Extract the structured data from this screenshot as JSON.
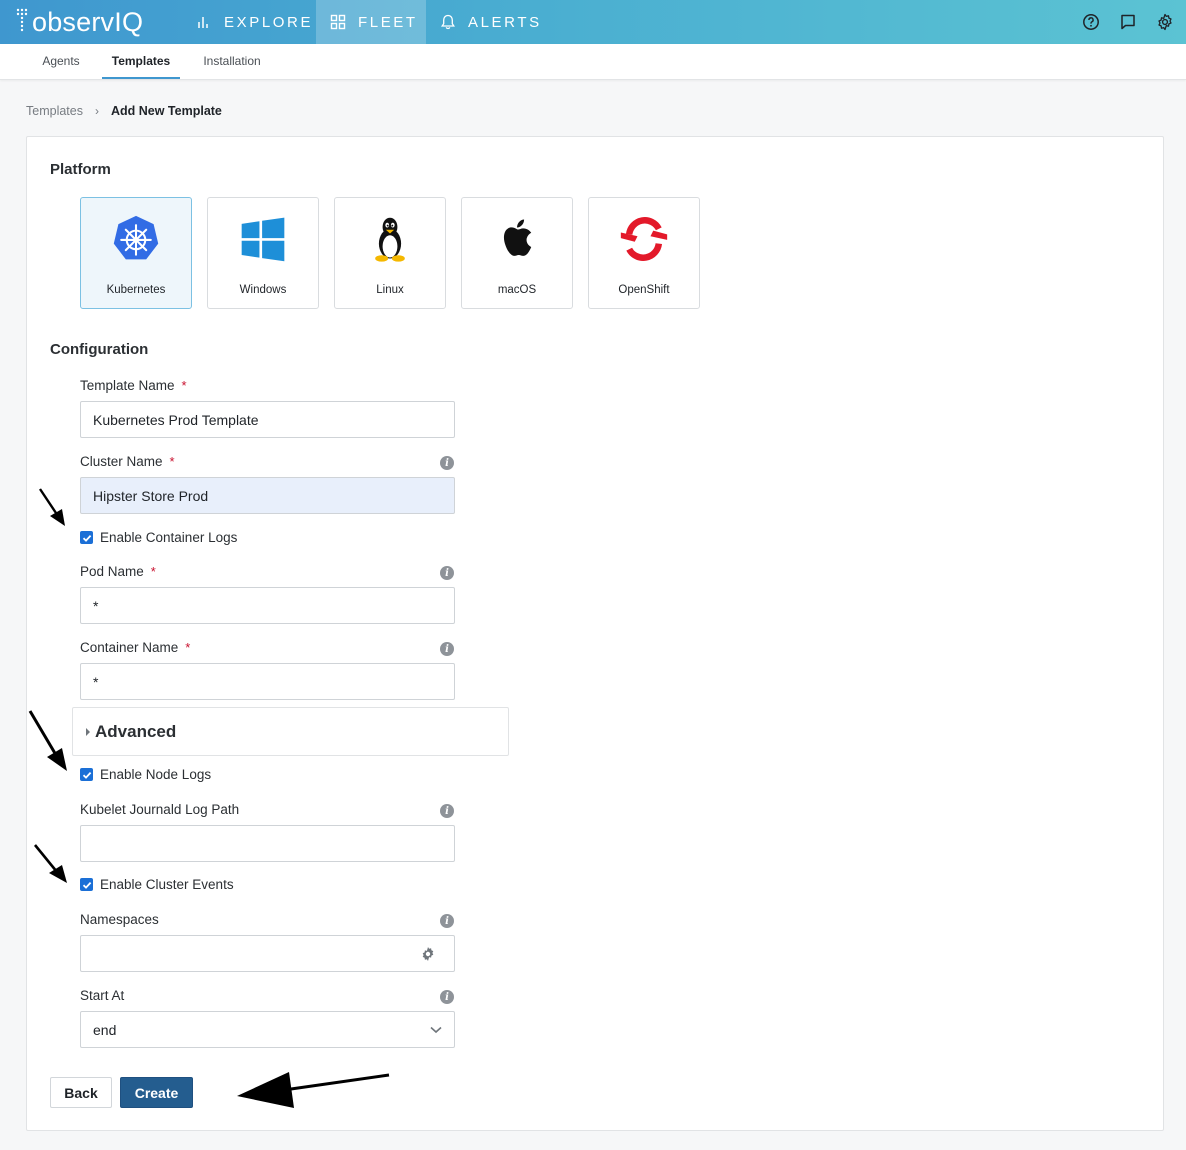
{
  "header": {
    "logo_text": "observIQ",
    "nav": [
      {
        "label": "EXPLORE",
        "icon": "bar-chart-icon"
      },
      {
        "label": "FLEET",
        "icon": "grid-icon",
        "active": true
      },
      {
        "label": "ALERTS",
        "icon": "bell-icon"
      }
    ],
    "right_icons": [
      "help-icon",
      "feedback-icon",
      "settings-icon"
    ]
  },
  "subtabs": [
    {
      "label": "Agents"
    },
    {
      "label": "Templates",
      "active": true
    },
    {
      "label": "Installation"
    }
  ],
  "breadcrumb": {
    "parent": "Templates",
    "separator": "›",
    "current": "Add New Template"
  },
  "platform": {
    "title": "Platform",
    "options": [
      {
        "label": "Kubernetes",
        "icon": "kubernetes-icon",
        "selected": true
      },
      {
        "label": "Windows",
        "icon": "windows-icon"
      },
      {
        "label": "Linux",
        "icon": "linux-tux-icon"
      },
      {
        "label": "macOS",
        "icon": "apple-icon"
      },
      {
        "label": "OpenShift",
        "icon": "openshift-icon"
      }
    ]
  },
  "configuration": {
    "title": "Configuration",
    "template_name": {
      "label": "Template Name",
      "required": "*",
      "value": "Kubernetes Prod Template"
    },
    "cluster_name": {
      "label": "Cluster Name",
      "required": "*",
      "value": "Hipster Store Prod"
    },
    "enable_container_logs": {
      "label": "Enable Container Logs",
      "checked": true
    },
    "pod_name": {
      "label": "Pod Name",
      "required": "*",
      "value": "*"
    },
    "container_name": {
      "label": "Container Name",
      "required": "*",
      "value": "*"
    },
    "advanced": {
      "label": "Advanced"
    },
    "enable_node_logs": {
      "label": "Enable Node Logs",
      "checked": true
    },
    "kubelet_path": {
      "label": "Kubelet Journald Log Path",
      "value": ""
    },
    "enable_cluster_events": {
      "label": "Enable Cluster Events",
      "checked": true
    },
    "namespaces": {
      "label": "Namespaces",
      "value": ""
    },
    "start_at": {
      "label": "Start At",
      "value": "end"
    }
  },
  "buttons": {
    "back": "Back",
    "create": "Create"
  },
  "colors": {
    "header_start": "#3f97cf",
    "header_end": "#5bc3d3",
    "primary_button": "#245d8f",
    "checkbox": "#1b6fd6",
    "required": "#c8102e"
  }
}
